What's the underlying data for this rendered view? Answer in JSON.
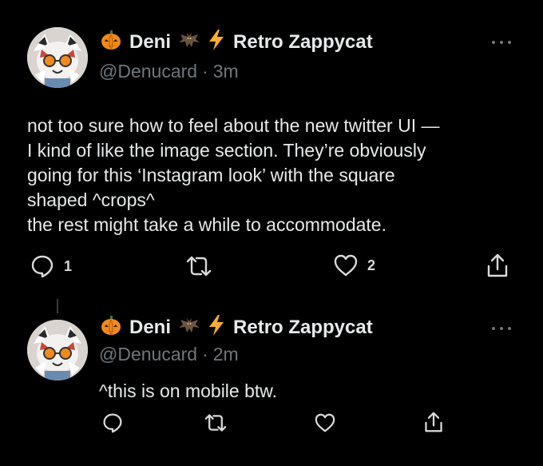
{
  "colors": {
    "background": "#000000",
    "text_primary": "#e7e9ea",
    "text_secondary": "#71767b",
    "divider": "#3a3d41"
  },
  "tweets": [
    {
      "name_part1": "Deni",
      "name_part2": "Retro Zappycat",
      "name_emojis": [
        "pumpkin-icon",
        "bat-icon",
        "lightning-icon"
      ],
      "handle": "@Denucard",
      "separator": "·",
      "time": "3m",
      "text_lines": [
        "not too sure how to feel about the new twitter UI —",
        "I kind of like the image section. They’re obviously",
        "going for this ‘Instagram look’ with the square",
        "shaped ^crops^",
        "the rest might take a while to accommodate."
      ],
      "reply_count": "1",
      "retweet_count": "",
      "like_count": "2"
    },
    {
      "name_part1": "Deni",
      "name_part2": "Retro Zappycat",
      "name_emojis": [
        "pumpkin-icon",
        "bat-icon",
        "lightning-icon"
      ],
      "handle": "@Denucard",
      "separator": "·",
      "time": "2m",
      "text_lines": [
        "^this is on mobile btw."
      ],
      "reply_count": "",
      "retweet_count": "",
      "like_count": ""
    }
  ]
}
